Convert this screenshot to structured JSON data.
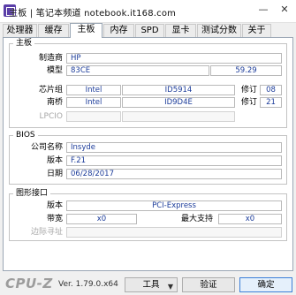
{
  "window": {
    "title": "主板 | 笔记本频道 notebook.it168.com",
    "minimize_glyph": "—",
    "close_glyph": "✕"
  },
  "tabs": [
    "处理器",
    "缓存",
    "主板",
    "内存",
    "SPD",
    "显卡",
    "测试分数",
    "关于"
  ],
  "active_tab": "主板",
  "mainboard": {
    "group_title": "主板",
    "manufacturer_label": "制造商",
    "manufacturer": "HP",
    "model_label": "模型",
    "model": "83CE",
    "model_rev": "59.29",
    "chipset_label": "芯片组",
    "chipset_vendor": "Intel",
    "chipset_id": "ID5914",
    "chipset_rev_label": "修订",
    "chipset_rev": "08",
    "southbridge_label": "南桥",
    "southbridge_vendor": "Intel",
    "southbridge_id": "ID9D4E",
    "southbridge_rev_label": "修订",
    "southbridge_rev": "21",
    "lpcio_label": "LPCIO"
  },
  "bios": {
    "group_title": "BIOS",
    "brand_label": "公司名称",
    "brand": "Insyde",
    "version_label": "版本",
    "version": "F.21",
    "date_label": "日期",
    "date": "06/28/2017"
  },
  "graphic_interface": {
    "group_title": "图形接口",
    "version_label": "版本",
    "version": "PCI-Express",
    "link_width_label": "带宽",
    "link_width": "x0",
    "max_supported_label": "最大支持",
    "max_supported": "x0",
    "side_band_label": "边际寻址"
  },
  "footer": {
    "brand": "CPU-Z",
    "version": "Ver. 1.79.0.x64",
    "tools_label": "工具",
    "tools_arrow": "▼",
    "validate_label": "验证",
    "ok_label": "确定"
  }
}
